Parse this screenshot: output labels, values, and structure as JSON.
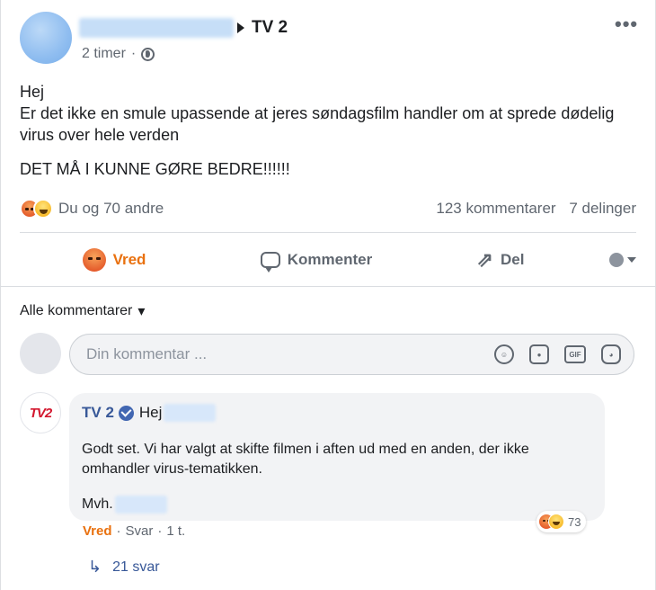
{
  "post": {
    "page_name": "TV 2",
    "timestamp": "2 timer",
    "text_line1": "Hej",
    "text_line2": "Er det ikke en smule upassende at jeres søndagsfilm handler om at sprede dødelig virus over hele verden",
    "text_line3": "DET MÅ I KUNNE GØRE BEDRE!!!!!!",
    "reactions_text": "Du og 70 andre",
    "comments_count": "123 kommentarer",
    "shares_count": "7 delinger",
    "more_label": "•••"
  },
  "actions": {
    "react_label": "Vred",
    "comment_label": "Kommenter",
    "share_label": "Del",
    "share_glyph": "⇗"
  },
  "comments": {
    "filter_label": "Alle kommentarer",
    "filter_caret": "▾",
    "composer_placeholder": "Din kommentar ...",
    "tools": {
      "gif_label": "GIF"
    }
  },
  "reply": {
    "logo_text": "TV2",
    "author": "TV 2",
    "greeting": "Hej",
    "body": "Godt set. Vi har valgt at skifte filmen i aften ud med en anden, der ikke omhandler virus-tematikken.",
    "signoff": "Mvh.",
    "reaction_count": "73",
    "vred_label": "Vred",
    "dot": "·",
    "reply_label": "Svar",
    "time": "1 t.",
    "replies_label": "21 svar",
    "replies_arrow": "↳"
  },
  "colors": {
    "link_blue": "#385898",
    "angry_orange": "#e9710f",
    "text_gray": "#606770"
  },
  "icons": [
    "globe-icon",
    "more-options-icon",
    "angry-emoji-icon",
    "haha-emoji-icon",
    "comment-icon",
    "share-icon",
    "audience-icon",
    "emoji-icon",
    "camera-icon",
    "gif-icon",
    "sticker-icon",
    "verified-icon",
    "reply-arrow-icon"
  ]
}
